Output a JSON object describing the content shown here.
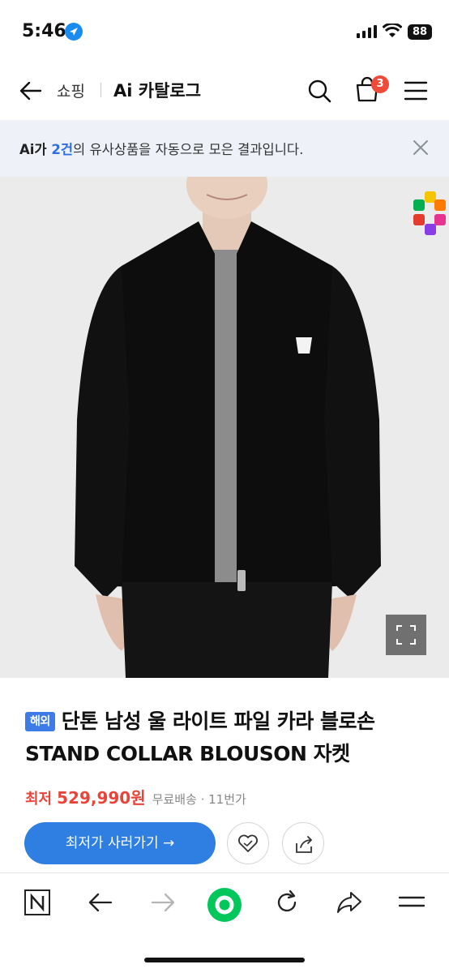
{
  "status_bar": {
    "time": "5:46",
    "battery": "88"
  },
  "header": {
    "section": "쇼핑",
    "title": "Ai 카탈로그",
    "cart_count": "3"
  },
  "notice": {
    "prefix": "Ai가 ",
    "count": "2건",
    "suffix": "의 유사상품을 자동으로 모은 결과입니다."
  },
  "product": {
    "badge": "해외",
    "name": "단톤 남성 울 라이트 파일 카라 블로손 STAND COLLAR BLOUSON 자켓",
    "price_label": "최저",
    "price": "529,990원",
    "shipping": "무료배송",
    "store": "11번가",
    "buy_label": "최저가 사러가기 →"
  },
  "colors": {
    "accent": "#2f7fe3",
    "price": "#e8443a",
    "badge": "#f04b3a",
    "notice_bg": "#eef2f8",
    "naver_green": "#03c75a"
  },
  "icons": [
    "back-icon",
    "search-icon",
    "cart-icon",
    "menu-icon",
    "close-icon",
    "expand-icon",
    "heart-icon",
    "share-icon",
    "naver-icon",
    "arrow-left-icon",
    "arrow-right-icon",
    "green-dot-icon",
    "refresh-icon",
    "forward-share-icon",
    "hamburger-icon"
  ]
}
